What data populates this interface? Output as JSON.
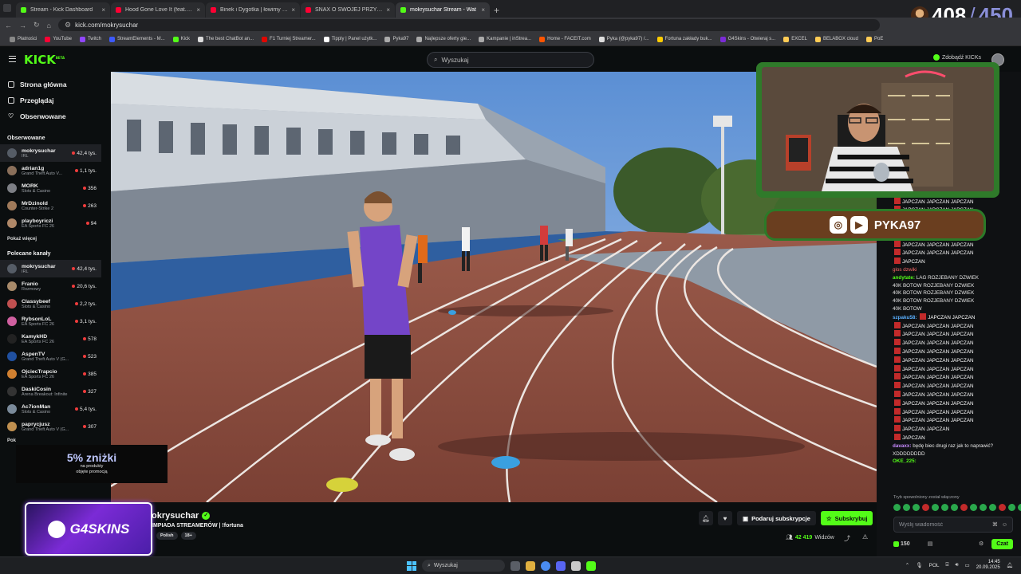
{
  "browser": {
    "tabs": [
      {
        "title": "Stream - Kick Dashboard",
        "color": "#53fc18",
        "active": false
      },
      {
        "title": "Hood Gone Love It (feat. Kendrick",
        "color": "#ff0033",
        "active": false
      },
      {
        "title": "Binek i Dygotka | łowimy na Ba",
        "color": "#ff0033",
        "active": false
      },
      {
        "title": "SNAX O SWOJEJ PRZYSZŁOŚCI",
        "color": "#ff0033",
        "active": false
      },
      {
        "title": "mokrysuchar Stream - Wat",
        "color": "#53fc18",
        "active": true
      }
    ],
    "new_tab": "+",
    "url": "kick.com/mokrysuchar",
    "bookmarks": [
      {
        "label": "Płatności",
        "color": "#888888"
      },
      {
        "label": "YouTube",
        "color": "#ff0033"
      },
      {
        "label": "Twitch",
        "color": "#9146ff"
      },
      {
        "label": "StreamElements - M...",
        "color": "#3d5afe"
      },
      {
        "label": "Kick",
        "color": "#53fc18"
      },
      {
        "label": "The best ChatBot an...",
        "color": "#dddddd"
      },
      {
        "label": "F1 Turniej Streamer...",
        "color": "#e10600"
      },
      {
        "label": "Tipply | Panel użytk...",
        "color": "#ffffff"
      },
      {
        "label": "Pyka97",
        "color": "#aaaaaa"
      },
      {
        "label": "Najlepsze oferty gie...",
        "color": "#aaaaaa"
      },
      {
        "label": "Kampanie | inStrea...",
        "color": "#aaaaaa"
      },
      {
        "label": "Home - FACEIT.com",
        "color": "#ff5500"
      },
      {
        "label": "Pyka (@pyka97) /...",
        "color": "#dddddd"
      },
      {
        "label": "Fortuna zakłady buk...",
        "color": "#ffcc00"
      },
      {
        "label": "G4Skins - Otwieraj s...",
        "color": "#7b2bd6"
      },
      {
        "label": "EXCEL",
        "color": "#ffcc55"
      },
      {
        "label": "BELABOX cloud",
        "color": "#ffcc55"
      },
      {
        "label": "PoE",
        "color": "#ffcc55"
      }
    ]
  },
  "overlay_counter": {
    "current": "408",
    "separator": "/",
    "max": "450"
  },
  "header": {
    "logo": "KICK",
    "logo_tag": "BETA",
    "search_placeholder": "Wyszukaj",
    "kicks_label": "Zdobądź KICKs"
  },
  "sidebar": {
    "nav": [
      {
        "label": "Strona główna",
        "icon": "home-icon"
      },
      {
        "label": "Przeglądaj",
        "icon": "browse-icon"
      },
      {
        "label": "Obserwowane",
        "icon": "heart-icon"
      }
    ],
    "followed_title": "Obserwowane",
    "followed": [
      {
        "name": "mokrysuchar",
        "category": "IRL",
        "viewers": "42,4 tys.",
        "color": "#555c66",
        "selected": true
      },
      {
        "name": "adrian1g",
        "category": "Grand Theft Auto V...",
        "viewers": "1,1 tys.",
        "color": "#8a6f5a"
      },
      {
        "name": "MORK",
        "category": "Slots & Casino",
        "viewers": "356",
        "color": "#7d7f85"
      },
      {
        "name": "MrDzinold",
        "category": "Counter-Strike 2",
        "viewers": "263",
        "color": "#a07a5a"
      },
      {
        "name": "playboyriczi",
        "category": "EA Sports FC 26",
        "viewers": "94",
        "color": "#b08868"
      }
    ],
    "show_more": "Pokaż więcej",
    "recommended_title": "Polecane kanały",
    "recommended": [
      {
        "name": "mokrysuchar",
        "category": "IRL",
        "viewers": "42,4 tys.",
        "color": "#555c66",
        "selected": true
      },
      {
        "name": "Franio",
        "category": "Rozmowy",
        "viewers": "20,6 tys.",
        "color": "#a88a6a"
      },
      {
        "name": "Classybeef",
        "category": "Slots & Casino",
        "viewers": "2,2 tys.",
        "color": "#c05050"
      },
      {
        "name": "RybsonLoL",
        "category": "EA Sports FC 26",
        "viewers": "3,1 tys.",
        "color": "#d060a0"
      },
      {
        "name": "KamykHD",
        "category": "EA Sports FC 26",
        "viewers": "578",
        "color": "#222222"
      },
      {
        "name": "AspenTV",
        "category": "Grand Theft Auto V (G...",
        "viewers": "523",
        "color": "#2050a0"
      },
      {
        "name": "OjciecTrapcio",
        "category": "EA Sports FC 26",
        "viewers": "385",
        "color": "#d08030"
      },
      {
        "name": "DaskiCosin",
        "category": "Arena Breakout: Infinite",
        "viewers": "327",
        "color": "#333333"
      },
      {
        "name": "Ac7ionMan",
        "category": "Slots & Casino",
        "viewers": "5,4 tys.",
        "color": "#7a8a9a"
      },
      {
        "name": "paprycjusz",
        "category": "Grand Theft Auto V (G...",
        "viewers": "307",
        "color": "#c09050"
      }
    ],
    "show_more_2": "Pok"
  },
  "promo": {
    "big": "5% zniżki",
    "line1": "na produkty",
    "line2": "objęte promocją"
  },
  "g4skins": {
    "label": "G4SKINS"
  },
  "social": {
    "handle": "PYKA97"
  },
  "chat": {
    "spam_word": "JAPCZAN",
    "messages": [
      {
        "user": "",
        "text": "JAPCZAN JAPCZAN JAPCZAN",
        "spam": true
      },
      {
        "user": "",
        "text": "JAPCZAN JAPCZAN JAPCZAN",
        "spam": true
      },
      {
        "user": "",
        "text": "JAPCZAN JAPCZAN JAPCZAN",
        "spam": true
      },
      {
        "user": "",
        "text": "JAPCZAN JAPCZAN JAPCZAN",
        "spam": true
      },
      {
        "user": "",
        "text": "JAPCZAN JAPCZAN JAPCZAN",
        "spam": true
      },
      {
        "user": "",
        "text": "JAPCZAN JAPCZAN",
        "spam": true
      },
      {
        "user": "",
        "text": "JAPCZAN JAPCZAN",
        "spam": true
      },
      {
        "user": "",
        "text": "JAPCZAN JAPCZAN JAPCZAN",
        "spam": true
      },
      {
        "user": "",
        "text": "JAPCZAN JAPCZAN JAPCZAN",
        "spam": true
      },
      {
        "user": "",
        "text": "JAPCZAN",
        "spam": true
      },
      {
        "user": "",
        "text": "glos dzwiki",
        "user_color": "#ff6b6b"
      },
      {
        "user": "andytate:",
        "text": "LAG ROZJEBANY DZWIEK",
        "user_color": "#53fc18"
      },
      {
        "user": "",
        "text": "40K BOTOW ROZJEBANY DZWIEK"
      },
      {
        "user": "",
        "text": "40K BOTOW ROZJEBANY DZWIEK"
      },
      {
        "user": "",
        "text": "40K BOTOW ROZJEBANY DZWIEK"
      },
      {
        "user": "",
        "text": "40K BOTOW"
      },
      {
        "user": "szpaku58:",
        "text": "JAPCZAN JAPCZAN",
        "user_color": "#5ab0ff",
        "spam": true
      },
      {
        "user": "",
        "text": "JAPCZAN JAPCZAN JAPCZAN",
        "spam": true
      },
      {
        "user": "",
        "text": "JAPCZAN JAPCZAN JAPCZAN",
        "spam": true
      },
      {
        "user": "",
        "text": "JAPCZAN JAPCZAN JAPCZAN",
        "spam": true
      },
      {
        "user": "",
        "text": "JAPCZAN JAPCZAN JAPCZAN",
        "spam": true
      },
      {
        "user": "",
        "text": "JAPCZAN JAPCZAN JAPCZAN",
        "spam": true
      },
      {
        "user": "",
        "text": "JAPCZAN JAPCZAN JAPCZAN",
        "spam": true
      },
      {
        "user": "",
        "text": "JAPCZAN JAPCZAN JAPCZAN",
        "spam": true
      },
      {
        "user": "",
        "text": "JAPCZAN JAPCZAN JAPCZAN",
        "spam": true
      },
      {
        "user": "",
        "text": "JAPCZAN JAPCZAN JAPCZAN",
        "spam": true
      },
      {
        "user": "",
        "text": "JAPCZAN JAPCZAN JAPCZAN",
        "spam": true
      },
      {
        "user": "",
        "text": "JAPCZAN JAPCZAN JAPCZAN",
        "spam": true
      },
      {
        "user": "",
        "text": "JAPCZAN JAPCZAN JAPCZAN",
        "spam": true
      },
      {
        "user": "",
        "text": "JAPCZAN JAPCZAN",
        "spam": true
      },
      {
        "user": "",
        "text": "JAPCZAN",
        "spam": true
      },
      {
        "user": "davaxx:",
        "text": "będę biec drugi raz jak to naprawić?",
        "user_color": "#c88bff"
      },
      {
        "user": "",
        "text": "XDDDDDDDD"
      },
      {
        "user": "OKE_225:",
        "text": "",
        "user_color": "#53fc18"
      }
    ],
    "notice": "Tryb spowolniony został włączony",
    "input_placeholder": "Wyślij wiadomość",
    "points": "150",
    "send": "Czat"
  },
  "stream": {
    "name": "okrysuchar",
    "title": "IMPIADA STREAMERÓW | !fortuna",
    "tags": [
      "Polish",
      "18+"
    ],
    "gift_label": "Podaruj subskrypcje",
    "subscribe_label": "Subskrybuj",
    "viewers": "42 419",
    "viewers_suffix": "Widzów"
  },
  "taskbar": {
    "search": "Wyszukaj",
    "lang": "POL",
    "time": "14:45",
    "date": "20.09.2025"
  }
}
